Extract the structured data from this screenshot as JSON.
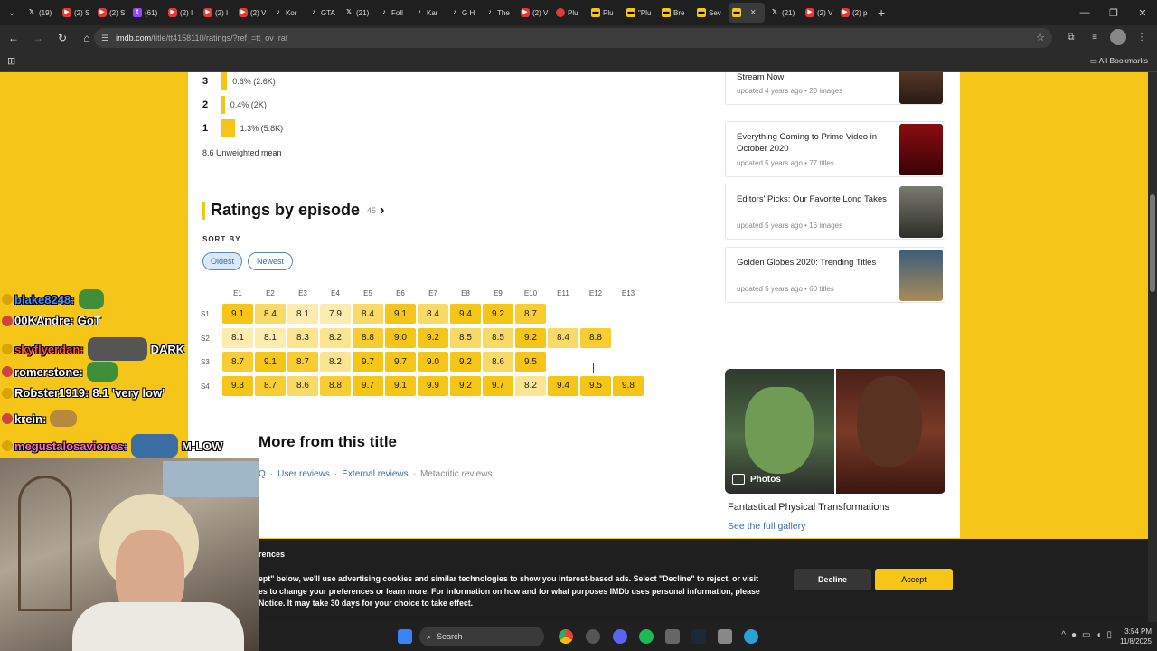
{
  "browser": {
    "tabs": [
      {
        "icon": "x-icon",
        "label": "(19)"
      },
      {
        "icon": "youtube-icon",
        "label": "(2) S"
      },
      {
        "icon": "youtube-icon",
        "label": "(2) S"
      },
      {
        "icon": "twitch-icon",
        "label": "(61)"
      },
      {
        "icon": "youtube-icon",
        "label": "(2) I"
      },
      {
        "icon": "youtube-icon",
        "label": "(2) I"
      },
      {
        "icon": "youtube-icon",
        "label": "(2) V"
      },
      {
        "icon": "tiktok-icon",
        "label": "Kor"
      },
      {
        "icon": "tiktok-icon",
        "label": "GTA"
      },
      {
        "icon": "x-icon",
        "label": "(21)"
      },
      {
        "icon": "tiktok-icon",
        "label": "Foll"
      },
      {
        "icon": "tiktok-icon",
        "label": "Kar"
      },
      {
        "icon": "tiktok-icon",
        "label": "G H"
      },
      {
        "icon": "tiktok-icon",
        "label": "The"
      },
      {
        "icon": "youtube-icon",
        "label": "(2) V"
      },
      {
        "icon": "pluribus-icon",
        "label": "Plu"
      },
      {
        "icon": "imdb-icon",
        "label": "Plu"
      },
      {
        "icon": "imdb-icon",
        "label": "\"Plu"
      },
      {
        "icon": "imdb-icon",
        "label": "Bre"
      },
      {
        "icon": "imdb-icon",
        "label": "Sev"
      },
      {
        "icon": "imdb-icon",
        "label": ""
      },
      {
        "icon": "x-icon",
        "label": "(21)"
      },
      {
        "icon": "youtube-icon",
        "label": "(2) V"
      },
      {
        "icon": "youtube-icon",
        "label": "(2) p"
      }
    ],
    "active_tab_index": 20,
    "url_host": "imdb.com",
    "url_path": "/title/tt4158110/ratings/?ref_=tt_ov_rat",
    "all_bookmarks": "All Bookmarks"
  },
  "distribution": [
    {
      "star": "3",
      "label": "0.6% (2.6K)",
      "pct": 0.6
    },
    {
      "star": "2",
      "label": "0.4% (2K)",
      "pct": 0.4
    },
    {
      "star": "1",
      "label": "1.3% (5.8K)",
      "pct": 1.3
    }
  ],
  "unweighted_mean": "8.6 Unweighted mean",
  "ratings_by_episode": {
    "title": "Ratings by episode",
    "count": "45",
    "sort_by": "SORT BY",
    "sort_options": [
      "Oldest",
      "Newest"
    ],
    "selected_sort": "Oldest",
    "episodes": [
      "E1",
      "E2",
      "E3",
      "E4",
      "E5",
      "E6",
      "E7",
      "E8",
      "E9",
      "E10",
      "E11",
      "E12",
      "E13"
    ],
    "seasons": [
      {
        "label": "S1",
        "ratings": [
          "9.1",
          "8.4",
          "8.1",
          "7.9",
          "8.4",
          "9.1",
          "8.4",
          "9.4",
          "9.2",
          "8.7"
        ]
      },
      {
        "label": "S2",
        "ratings": [
          "8.1",
          "8.1",
          "8.3",
          "8.2",
          "8.8",
          "9.0",
          "9.2",
          "8.5",
          "8.5",
          "9.2",
          "8.4",
          "8.8"
        ]
      },
      {
        "label": "S3",
        "ratings": [
          "8.7",
          "9.1",
          "8.7",
          "8.2",
          "9.7",
          "9.7",
          "9.0",
          "9.2",
          "8.6",
          "9.5"
        ]
      },
      {
        "label": "S4",
        "ratings": [
          "9.3",
          "8.7",
          "8.6",
          "8.8",
          "9.7",
          "9.1",
          "9.9",
          "9.2",
          "9.7",
          "8.2",
          "9.4",
          "9.5",
          "9.8"
        ]
      }
    ]
  },
  "more_from_title": {
    "title": "More from this title",
    "links": [
      "Q",
      "User reviews",
      "External reviews",
      "Metacritic reviews"
    ]
  },
  "sidebar_lists": [
    {
      "title": "Stream Now",
      "meta": "updated 4 years ago • 20 images"
    },
    {
      "title": "Everything Coming to Prime Video in October 2020",
      "meta": "updated 5 years ago • 77 titles"
    },
    {
      "title": "Editors' Picks: Our Favorite Long Takes",
      "meta": "updated 5 years ago • 16 images"
    },
    {
      "title": "Golden Globes 2020: Trending Titles",
      "meta": "updated 5 years ago • 60 titles"
    }
  ],
  "photos": {
    "label": "Photos",
    "gallery_title": "Fantastical Physical Transformations",
    "gallery_link": "See the full gallery"
  },
  "chat": [
    {
      "user": "blake8248:",
      "msg": "",
      "color": "#4a8cff"
    },
    {
      "user": "00KAndre:",
      "msg": "GoT",
      "color": "#ffffff"
    },
    {
      "user": "skyflyerdan:",
      "msg": "DARK",
      "color": "#ff4d4d"
    },
    {
      "user": "romerstone:",
      "msg": "",
      "color": "#ffffff"
    },
    {
      "user": "Robster1919:",
      "msg": "8.1 'very low'",
      "color": "#ffffff"
    },
    {
      "user": "krein:",
      "msg": "",
      "color": "#ffffff"
    },
    {
      "user": "megustalosaviones:",
      "msg": "M-LOW",
      "color": "#ff66cc"
    }
  ],
  "cookie": {
    "title": "rences",
    "line1": "ept\" below, we'll use advertising cookies and similar technologies to show you interest-based ads. Select \"Decline\" to reject, or visit",
    "line2": "es to change your preferences or learn more. For information on how and for what purposes IMDb uses personal information, please",
    "line3": "Notice. It may take 30 days for your choice to take effect.",
    "decline": "Decline",
    "accept": "Accept"
  },
  "taskbar": {
    "search": "Search",
    "time": "3:54 PM",
    "date": "11/8/2025"
  }
}
